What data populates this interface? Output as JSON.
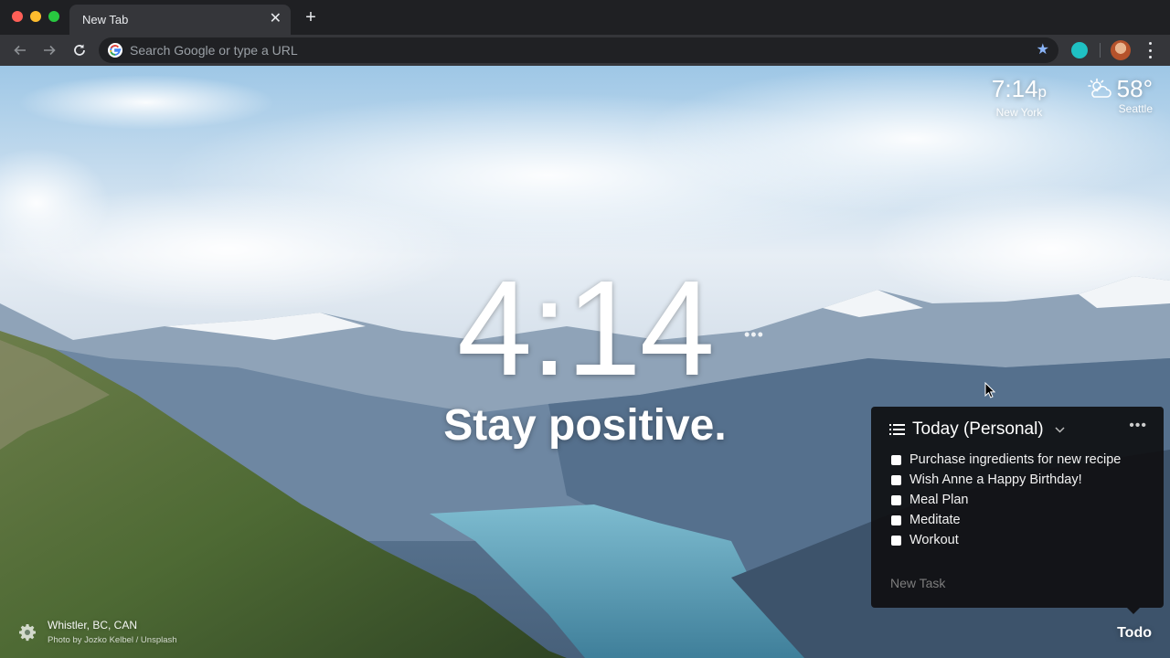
{
  "browser": {
    "tab_title": "New Tab",
    "tab_close": "✕",
    "new_tab": "+",
    "omnibox_placeholder": "Search Google or type a URL",
    "star_icon": "★",
    "accent_color": "#8ab4f8"
  },
  "dashboard": {
    "local_time": "7:14",
    "local_ampm": "p",
    "local_city": "New York",
    "weather_temp": "58°",
    "weather_city": "Seattle",
    "weather_icon": "partly-cloudy-icon",
    "main_time": "4:14",
    "main_time_more": "•••",
    "mantra": "Stay positive."
  },
  "todo": {
    "title": "Today (Personal)",
    "chevron": "⌄",
    "more": "•••",
    "items": [
      {
        "text": "Purchase ingredients for new recipe",
        "done": false
      },
      {
        "text": "Wish Anne a Happy Birthday!",
        "done": false
      },
      {
        "text": "Meal Plan",
        "done": false
      },
      {
        "text": "Meditate",
        "done": false
      },
      {
        "text": "Workout",
        "done": false
      }
    ],
    "new_task_placeholder": "New Task",
    "toggle_label": "Todo"
  },
  "photo": {
    "location": "Whistler, BC, CAN",
    "credit": "Photo by Jozko Kelbel / Unsplash"
  }
}
